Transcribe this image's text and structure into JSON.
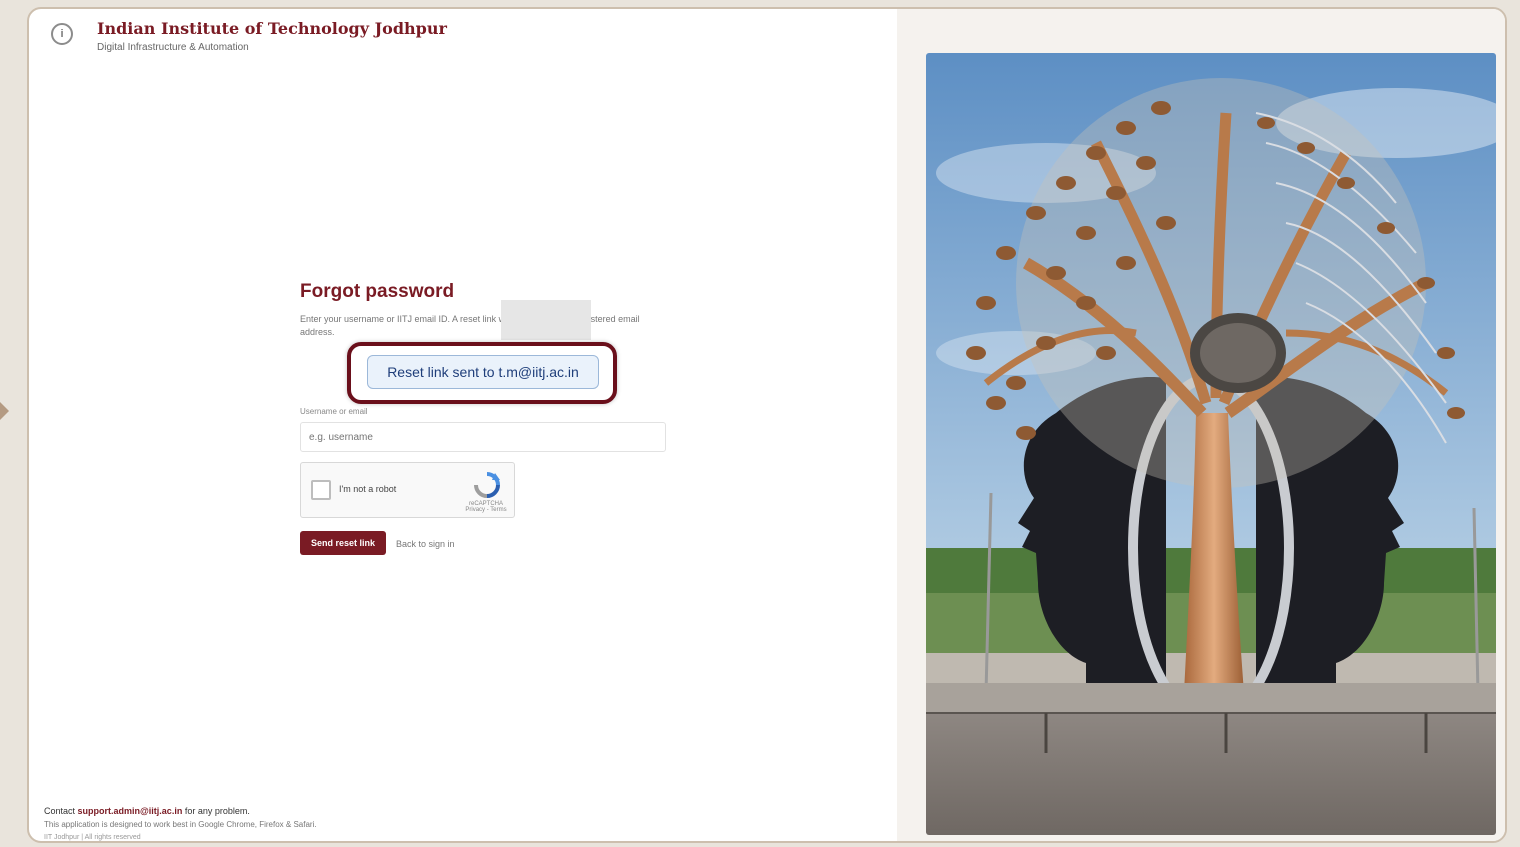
{
  "header": {
    "institute_name": "Indian Institute of Technology Jodhpur",
    "subtitle": "Digital Infrastructure & Automation",
    "logo_icon": "institute-logo-icon"
  },
  "form": {
    "title": "Forgot password",
    "description": "Enter your username or IITJ email ID. A reset link will be sent to your registered email address.",
    "notice": "Reset link sent to t.m@iitj.ac.in",
    "username_label": "Username or email",
    "username_placeholder": "e.g. username",
    "captcha_label": "I'm not a robot",
    "captcha_brand": "reCAPTCHA",
    "captcha_terms": "Privacy - Terms",
    "submit_label": "Send reset link",
    "back_link": "Back to sign in"
  },
  "footer": {
    "line1_prefix": "Contact ",
    "support_email": "support.admin@iitj.ac.in",
    "line1_suffix": " for any problem.",
    "line2": "This application is designed to work best in Google Chrome, Firefox & Safari.",
    "line3": "IIT Jodhpur | All rights reserved"
  },
  "colors": {
    "brand": "#7a1b24",
    "notice_bg": "#eaf2fb",
    "notice_text": "#1f3e7a"
  },
  "photo": {
    "subject": "tree-sculpture-with-two-faces-photo"
  }
}
